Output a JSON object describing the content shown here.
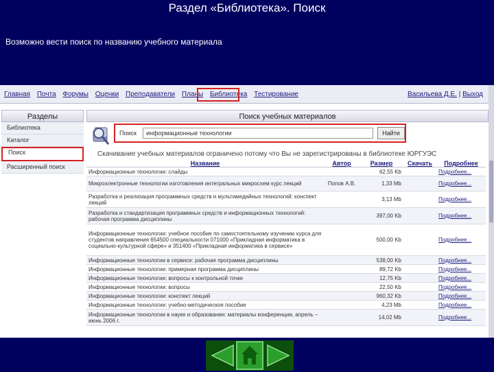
{
  "slide": {
    "title": "Раздел «Библиотека». Поиск",
    "subtitle": "Возможно вести поиск по названию учебного материала"
  },
  "topnav": {
    "items": [
      "Главная",
      "Почта",
      "Форумы",
      "Оценки",
      "Преподаватели",
      "Планы",
      "Библиотека",
      "Тестирование"
    ],
    "user": "Васильева Д.Е.",
    "logout": "Выход"
  },
  "sidebar": {
    "header": "Разделы",
    "items": [
      "Библиотека",
      "Каталог",
      "Поиск",
      "Расширенный поиск"
    ]
  },
  "main": {
    "header": "Поиск учебных материалов",
    "search_label": "Поиск",
    "search_value": "информационные технологии",
    "search_button": "Найти",
    "notice": "Скачивание учебных материалов ограничено потому что Вы не зарегистрированы в библиотеке ЮРГУЭС"
  },
  "results": {
    "columns": [
      "Название",
      "Автор",
      "Размер",
      "Скачать",
      "Подробнее"
    ],
    "rows": [
      {
        "title": "Информационные технологии: слайды",
        "author": "",
        "size": "62,55 Kb",
        "more": "Подробнее..."
      },
      {
        "title": "Микроэлектронные технологии изготовления интегральных микросхем курс лекций",
        "author": "Попов А.В.",
        "size": "1,33 Mb",
        "more": "Подробнее..."
      },
      {
        "title": "Разработка и реализация программных средств и мультимедийных технологий: конспект лекций",
        "author": "",
        "size": "3,13 Mb",
        "more": "Подробнее..."
      },
      {
        "title": "Разработка и стандартизация программных средств и информационных технологий: рабочая программа дисциплины",
        "author": "",
        "size": "397,00 Kb",
        "more": "Подробнее..."
      },
      {
        "title": "Информационные технологии: учебное пособие по самостоятельному изучению курса для студентов направления 654500 специальности 071000 «Прикладная информатика в социально-культурной сфере» и 351400 «Прикладная информатика в сервисе»",
        "author": "",
        "size": "500,00 Kb",
        "more": "Подробнее..."
      },
      {
        "title": "Информационные технологии в сервисе: рабочая программа дисциплины",
        "author": "",
        "size": "538,00 Kb",
        "more": "Подробнее..."
      },
      {
        "title": "Информационные технологии: примерная программа дисциплины",
        "author": "",
        "size": "89,72 Kb",
        "more": "Подробнее..."
      },
      {
        "title": "Информационные технологии: вопросы к контрольной точке",
        "author": "",
        "size": "12,75 Kb",
        "more": "Подробнее..."
      },
      {
        "title": "Информационные технологии: вопросы",
        "author": "",
        "size": "22,50 Kb",
        "more": "Подробнее..."
      },
      {
        "title": "Информационные технологии: конспект лекций",
        "author": "",
        "size": "960,32 Kb",
        "more": "Подробнее..."
      },
      {
        "title": "Информационные технологии: учебно-методическое пособие",
        "author": "",
        "size": "4,23 Mb",
        "more": "Подробнее..."
      },
      {
        "title": "Информационные технологии в науке и образовании: материалы конференции, апрель – июнь 2006 г.",
        "author": "",
        "size": "14,02 Mb",
        "more": "Подробнее..."
      }
    ]
  },
  "slidenav": {
    "prev": "triangle-left-icon",
    "home": "home-icon",
    "next": "triangle-right-icon"
  },
  "colors": {
    "slide_bg": "#00005e",
    "highlight": "#d42020",
    "nav_green": "#2b9e2b"
  }
}
